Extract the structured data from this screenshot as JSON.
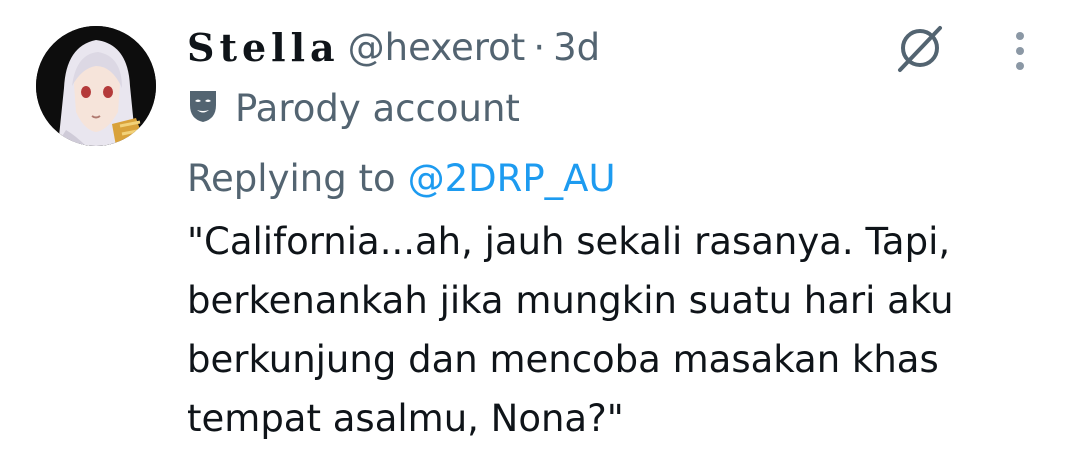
{
  "tweet": {
    "author": {
      "display_name": "Stella",
      "handle": "@hexerot",
      "separator": "·",
      "time": "3d",
      "label": "Parody account",
      "label_icon": "mask-icon",
      "avatar": "avatar-image"
    },
    "replying": {
      "prefix": "Replying to",
      "handle": "@2DRP_AU"
    },
    "text_lines": [
      "\"California...ah, jauh sekali rasanya. Tapi,",
      "berkenankah jika mungkin suatu hari aku",
      "berkunjung dan mencoba masakan khas",
      "tempat asalmu, Nona?\""
    ],
    "actions": {
      "grok_icon": "grok-icon",
      "more_icon": "more-vertical-icon"
    }
  },
  "colors": {
    "primary_text": "#0f1419",
    "secondary_text": "#536471",
    "link": "#1d9bf0",
    "background": "#ffffff"
  }
}
